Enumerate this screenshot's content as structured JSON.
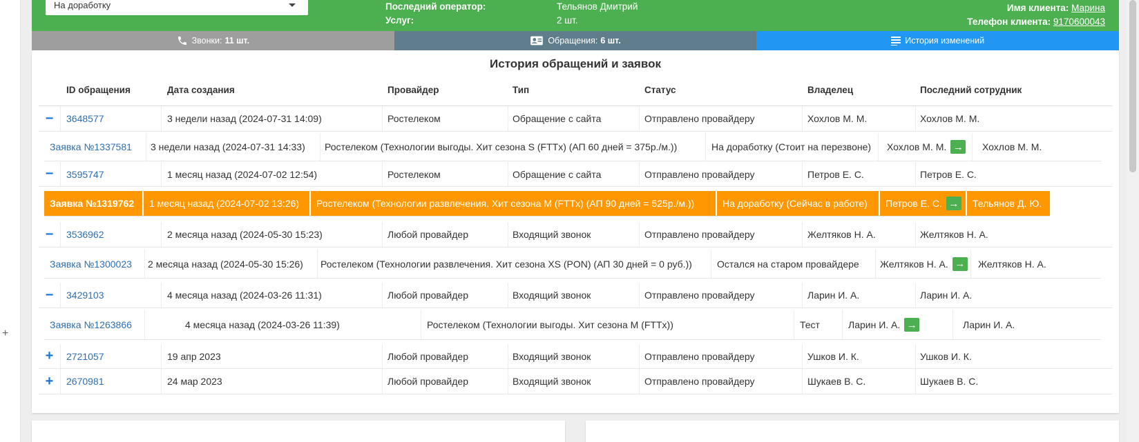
{
  "header": {
    "status_select_value": "На доработку",
    "last_operator_label": "Последний оператор:",
    "last_operator_value": "Тельянов Дмитрий",
    "services_label": "Услуг:",
    "services_value": "2 шт.",
    "client_name_label": "Имя клиента:",
    "client_name_value": "Марина",
    "client_phone_label": "Телефон клиента:",
    "client_phone_value": "9170600043"
  },
  "tabs": [
    {
      "label": "Звонки:",
      "count": "11 шт.",
      "icon": "phone-icon"
    },
    {
      "label": "Обращения:",
      "count": "6 шт.",
      "icon": "contact-card-icon"
    },
    {
      "label": "История изменений",
      "count": "",
      "icon": "list-icon"
    }
  ],
  "colors": {
    "header_green": "#4caf50",
    "tab_calls": "#9e9e9e",
    "tab_requests": "#607d8b",
    "tab_history": "#2196f3",
    "highlight": "#ff9800",
    "link": "#2f6fb0"
  },
  "history": {
    "title": "История обращений и заявок",
    "columns": [
      "ID обращения",
      "Дата создания",
      "Провайдер",
      "Тип",
      "Статус",
      "Владелец",
      "Последний сотрудник"
    ],
    "rows": [
      {
        "toggle": "−",
        "id": "3648577",
        "date": "3 недели назад (2024-07-31 14:09)",
        "provider": "Ростелеком",
        "type": "Обращение с сайта",
        "status": "Отправлено провайдеру",
        "owner": "Хохлов М. М.",
        "last": "Хохлов М. М."
      },
      {
        "toggle": "−",
        "id": "3595747",
        "date": "1 месяц назад (2024-07-02 12:54)",
        "provider": "Ростелеком",
        "type": "Обращение с сайта",
        "status": "Отправлено провайдеру",
        "owner": "Петров Е. С.",
        "last": "Петров Е. С."
      },
      {
        "toggle": "−",
        "id": "3536962",
        "date": "2 месяца назад (2024-05-30 15:23)",
        "provider": "Любой провайдер",
        "type": "Входящий звонок",
        "status": "Отправлено провайдеру",
        "owner": "Желтяков Н. А.",
        "last": "Желтяков Н. А."
      },
      {
        "toggle": "−",
        "id": "3429103",
        "date": "4 месяца назад (2024-03-26 11:31)",
        "provider": "Любой провайдер",
        "type": "Входящий звонок",
        "status": "Отправлено провайдеру",
        "owner": "Ларин И. А.",
        "last": "Ларин И. А."
      },
      {
        "toggle": "+",
        "id": "2721057",
        "date": "19 апр 2023",
        "provider": "Любой провайдер",
        "type": "Входящий звонок",
        "status": "Отправлено провайдеру",
        "owner": "Ушков И. К.",
        "last": "Ушков И. К."
      },
      {
        "toggle": "+",
        "id": "2670981",
        "date": "24 мар 2023",
        "provider": "Любой провайдер",
        "type": "Входящий звонок",
        "status": "Отправлено провайдеру",
        "owner": "Шукаев В. С.",
        "last": "Шукаев В. С."
      }
    ],
    "orders": [
      {
        "id": "Заявка №1337581",
        "date": "3 недели назад (2024-07-31 14:33)",
        "tariff": "Ростелеком (Технологии выгоды. Хит сезона S (FTTx) (АП 60 дней = 375р./м.))",
        "status": "На доработку (Стоит на перезвоне)",
        "owner": "Хохлов М. М.",
        "last": "Хохлов М. М.",
        "arrow": "→"
      },
      {
        "id": "Заявка №1319762",
        "date": "1 месяц назад (2024-07-02 13:26)",
        "tariff": "Ростелеком (Технологии развлечения. Хит сезона M (FTTx) (АП 90 дней = 525р./м.))",
        "status": "На доработку (Сейчас в работе)",
        "owner": "Петров Е. С.",
        "last": "Тельянов Д. Ю.",
        "arrow": "→"
      },
      {
        "id": "Заявка №1300023",
        "date": "2 месяца назад (2024-05-30 15:26)",
        "tariff": "Ростелеком (Технологии развлечения. Хит сезона XS (PON) (АП 30 дней = 0 руб.))",
        "status": "Остался на старом провайдере",
        "owner": "Желтяков Н. А.",
        "last": "Желтяков Н. А.",
        "arrow": "→"
      },
      {
        "id": "Заявка №1263866",
        "date": "4 месяца назад (2024-03-26 11:39)",
        "tariff": "Ростелеком (Технологии выгоды. Хит сезона M (FTTx))",
        "status": "Тест",
        "owner": "Ларин И. А.",
        "last": "Ларин И. А.",
        "arrow": "→"
      }
    ]
  }
}
